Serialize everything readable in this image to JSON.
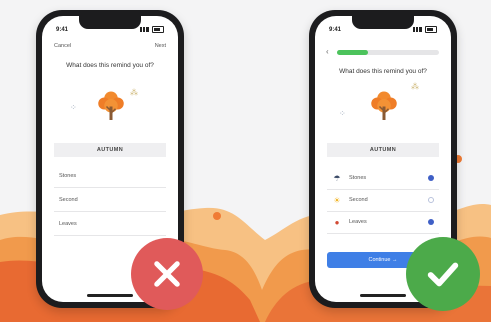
{
  "colors": {
    "background": "#f4f4f5",
    "wave_dark": "#e4612c",
    "wave_mid": "#ee8a3c",
    "wave_light": "#f4b061",
    "accent_orange": "#f07b34",
    "progress_green": "#4cc35c",
    "continue_blue": "#3f7fe6",
    "wrong_red": "#e05a5a",
    "right_green": "#4caa4a"
  },
  "left_phone": {
    "status_time": "9:41",
    "cancel_label": "Cancel",
    "next_label": "Next",
    "question": "What does this remind you of?",
    "illustration": "autumn-tree-icon",
    "answer_label": "AUTUMN",
    "options": [
      {
        "label": "Stones"
      },
      {
        "label": "Second"
      },
      {
        "label": "Leaves"
      }
    ]
  },
  "right_phone": {
    "status_time": "9:41",
    "back_icon": "chevron-left-icon",
    "progress": 0.3,
    "question": "What does this remind you of?",
    "illustration": "autumn-tree-icon",
    "answer_label": "AUTUMN",
    "options": [
      {
        "icon": "rain-cloud-icon",
        "glyph": "☂",
        "label": "Stones",
        "selected": true
      },
      {
        "icon": "sun-icon",
        "glyph": "☀",
        "label": "Second",
        "selected": false
      },
      {
        "icon": "apple-icon",
        "glyph": "●",
        "label": "Leaves",
        "selected": true
      }
    ],
    "continue_label": "Continue →"
  },
  "badges": {
    "wrong_icon": "close-icon",
    "right_icon": "check-icon"
  }
}
